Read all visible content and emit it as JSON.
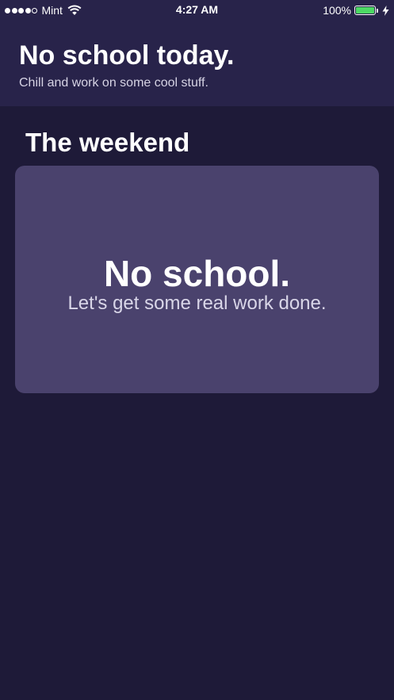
{
  "status_bar": {
    "carrier": "Mint",
    "signal_bars_filled": 4,
    "signal_bars_total": 5,
    "time": "4:27 AM",
    "battery_percent": "100%",
    "battery_level": 1.0,
    "charging": true,
    "icons": [
      "wifi-icon",
      "battery-icon",
      "charging-bolt-icon"
    ]
  },
  "header": {
    "title": "No school today.",
    "subtitle": "Chill and work on some cool stuff."
  },
  "section": {
    "title": "The weekend"
  },
  "card": {
    "title": "No school.",
    "subtitle": "Let's get some real work done."
  },
  "colors": {
    "background": "#1e1a38",
    "header_background": "#28234a",
    "card_background": "#4a426d",
    "battery_fill": "#4cd964"
  }
}
